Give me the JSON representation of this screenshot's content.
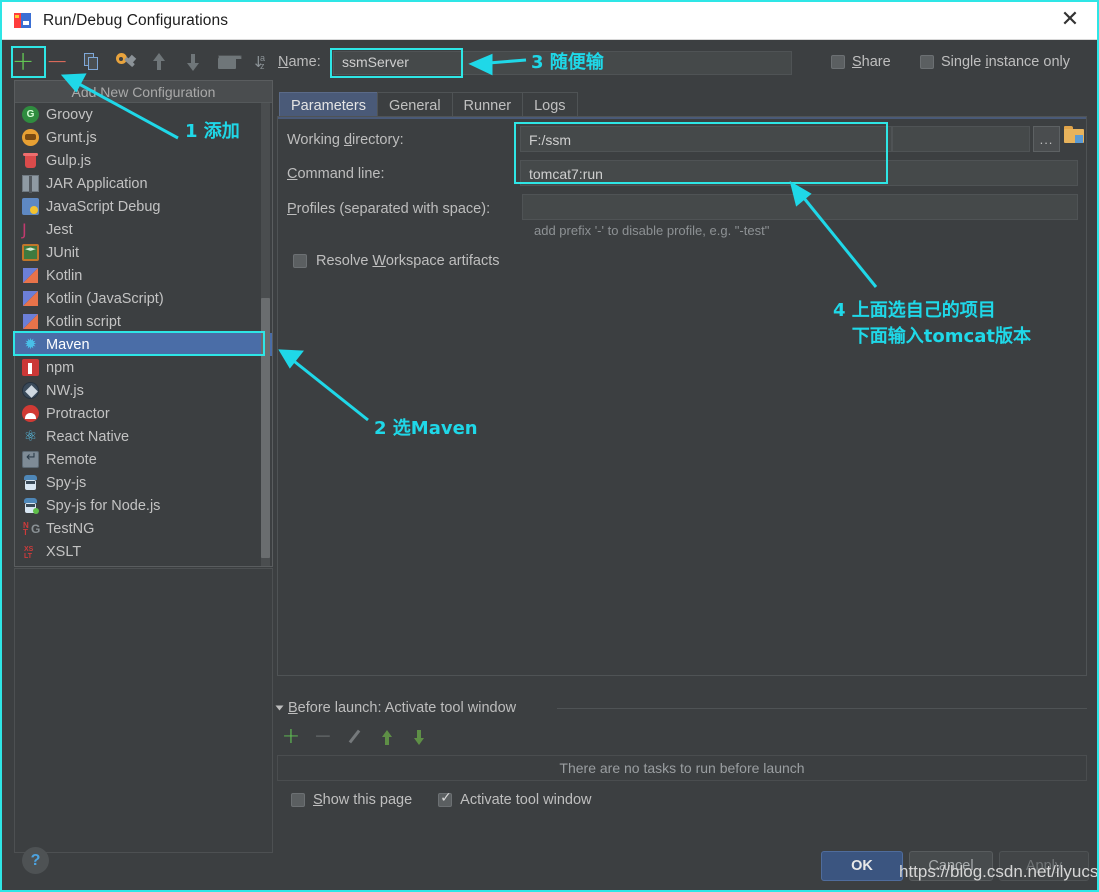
{
  "window": {
    "title": "Run/Debug Configurations",
    "close_label": "✕",
    "app_icon": "intellij-idea-icon"
  },
  "toolbar": {
    "items": [
      {
        "name": "add-configuration-button",
        "icon": "plus-icon",
        "label": "+"
      },
      {
        "name": "remove-configuration-button",
        "icon": "minus-icon",
        "label": "−"
      },
      {
        "name": "copy-configuration-button",
        "icon": "copy-icon"
      },
      {
        "name": "edit-templates-button",
        "icon": "wrench-icon"
      },
      {
        "name": "move-up-button",
        "icon": "arrow-up-icon"
      },
      {
        "name": "move-down-button",
        "icon": "arrow-down-icon"
      },
      {
        "name": "move-into-folder-button",
        "icon": "folder-icon"
      },
      {
        "name": "sort-configurations-button",
        "icon": "sort-az-icon",
        "label": "a\nz"
      }
    ]
  },
  "name_row": {
    "label": "Name:",
    "label_mnemonic": "N",
    "label_rest": "ame:",
    "value": "ssmServer",
    "share": {
      "label": "Share",
      "mnemonic": "S",
      "rest": "hare",
      "checked": false
    },
    "single_instance": {
      "label": "Single instance only",
      "prefix": "Single ",
      "mnemonic": "i",
      "rest": "nstance only",
      "checked": false
    }
  },
  "popup": {
    "header": "Add New Configuration",
    "items": [
      {
        "label": "Groovy",
        "icon": "groovy-icon",
        "selected": false
      },
      {
        "label": "Grunt.js",
        "icon": "grunt-icon",
        "selected": false
      },
      {
        "label": "Gulp.js",
        "icon": "gulp-icon",
        "selected": false
      },
      {
        "label": "JAR Application",
        "icon": "jar-icon",
        "selected": false
      },
      {
        "label": "JavaScript Debug",
        "icon": "javascript-debug-icon",
        "selected": false
      },
      {
        "label": "Jest",
        "icon": "jest-icon",
        "selected": false
      },
      {
        "label": "JUnit",
        "icon": "junit-icon",
        "selected": false
      },
      {
        "label": "Kotlin",
        "icon": "kotlin-icon",
        "selected": false
      },
      {
        "label": "Kotlin (JavaScript)",
        "icon": "kotlin-icon",
        "selected": false
      },
      {
        "label": "Kotlin script",
        "icon": "kotlin-icon",
        "selected": false
      },
      {
        "label": "Maven",
        "icon": "maven-icon",
        "selected": true
      },
      {
        "label": "npm",
        "icon": "npm-icon",
        "selected": false
      },
      {
        "label": "NW.js",
        "icon": "nwjs-icon",
        "selected": false
      },
      {
        "label": "Protractor",
        "icon": "protractor-icon",
        "selected": false
      },
      {
        "label": "React Native",
        "icon": "react-icon",
        "selected": false
      },
      {
        "label": "Remote",
        "icon": "remote-icon",
        "selected": false
      },
      {
        "label": "Spy-js",
        "icon": "spy-js-icon",
        "selected": false
      },
      {
        "label": "Spy-js for Node.js",
        "icon": "spy-js-node-icon",
        "selected": false
      },
      {
        "label": "TestNG",
        "icon": "testng-icon",
        "selected": false
      },
      {
        "label": "XSLT",
        "icon": "xslt-icon",
        "selected": false
      }
    ]
  },
  "tabs": [
    {
      "label": "Parameters",
      "active": true
    },
    {
      "label": "General",
      "active": false
    },
    {
      "label": "Runner",
      "active": false
    },
    {
      "label": "Logs",
      "active": false
    }
  ],
  "parameters": {
    "working_directory": {
      "label": "Working directory:",
      "label_pre": "Working ",
      "label_mn": "d",
      "label_post": "irectory:",
      "value": "F:/ssm"
    },
    "command_line": {
      "label": "Command line:",
      "label_mn": "C",
      "label_post": "ommand line:",
      "value": "tomcat7:run"
    },
    "profiles": {
      "label": "Profiles (separated with space):",
      "label_mn": "P",
      "label_post": "rofiles (separated with space):",
      "value": "",
      "hint": "add prefix '-' to disable profile, e.g. \"-test\""
    },
    "resolve_workspace": {
      "label": "Resolve Workspace artifacts",
      "pre": "Resolve ",
      "mn": "W",
      "post": "orkspace artifacts",
      "checked": false
    },
    "browse_button": "...",
    "folder_button_icon": "open-folder-icon"
  },
  "before_launch": {
    "title": "Before launch: Activate tool window",
    "title_mn": "B",
    "title_post": "efore launch: Activate tool window",
    "toolbar": [
      {
        "name": "add-task-button",
        "icon": "plus-icon"
      },
      {
        "name": "remove-task-button",
        "icon": "minus-icon"
      },
      {
        "name": "edit-task-button",
        "icon": "pencil-icon"
      },
      {
        "name": "task-move-up-button",
        "icon": "arrow-up-icon"
      },
      {
        "name": "task-move-down-button",
        "icon": "arrow-down-icon"
      }
    ],
    "empty_text": "There are no tasks to run before launch",
    "show_this_page": {
      "label": "Show this page",
      "pre": "",
      "mn": "S",
      "post": "how this page",
      "checked": false
    },
    "activate_tool_window": {
      "label": "Activate tool window",
      "checked": true
    }
  },
  "dialog_buttons": {
    "ok": "OK",
    "cancel": "Cancel",
    "apply": "Apply"
  },
  "annotations": [
    {
      "id": "anno-1",
      "text": "1 添加"
    },
    {
      "id": "anno-2",
      "text": "2 选Maven"
    },
    {
      "id": "anno-3",
      "text": "3 随便输"
    },
    {
      "id": "anno-4",
      "text": "4 上面选自己的项目\n   下面输入tomcat版本"
    }
  ],
  "watermark": "https://blog.csdn.net/ilyucs",
  "help_button": "?",
  "colors": {
    "annotation": "#1fd8e8",
    "background": "#3c3f41",
    "selection": "#4a6da7",
    "accent_tab": "#4a5a78",
    "ok_button": "#3b5580"
  }
}
